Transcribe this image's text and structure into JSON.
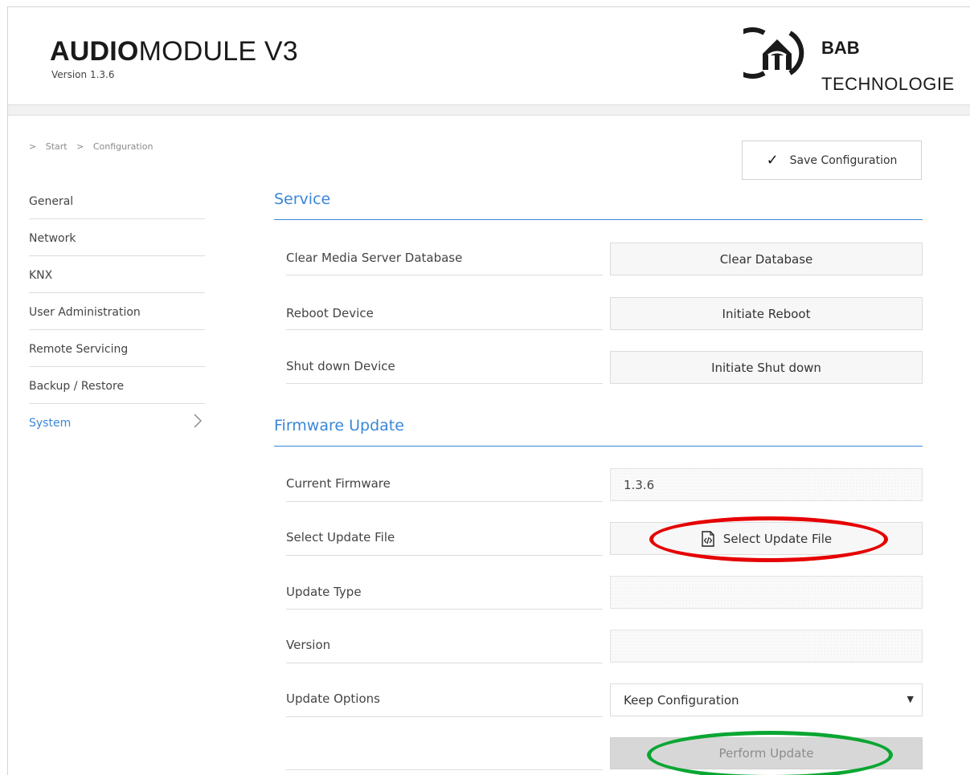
{
  "header": {
    "title_bold": "AUDIO",
    "title_rest": "MODULE V3",
    "version": "Version 1.3.6",
    "logo_line1": "BAB",
    "logo_line2": "TECHNOLOGIE"
  },
  "breadcrumb": [
    ">",
    "Start",
    ">",
    "Configuration"
  ],
  "toolbar": {
    "save_label": "Save Configuration"
  },
  "sidebar": {
    "items": [
      {
        "label": "General"
      },
      {
        "label": "Network"
      },
      {
        "label": "KNX"
      },
      {
        "label": "User Administration"
      },
      {
        "label": "Remote Servicing"
      },
      {
        "label": "Backup / Restore"
      },
      {
        "label": "System"
      }
    ],
    "active": "System"
  },
  "service": {
    "title": "Service",
    "rows": [
      {
        "label": "Clear Media Server Database",
        "button": "Clear Database"
      },
      {
        "label": "Reboot Device",
        "button": "Initiate Reboot"
      },
      {
        "label": "Shut down Device",
        "button": "Initiate Shut down"
      }
    ]
  },
  "firmware": {
    "title": "Firmware Update",
    "current_label": "Current Firmware",
    "current_value": "1.3.6",
    "select_label": "Select Update File",
    "select_button": "Select Update File",
    "type_label": "Update Type",
    "type_value": "",
    "version_label": "Version",
    "version_value": "",
    "options_label": "Update Options",
    "options_selected": "Keep Configuration",
    "perform_button": "Perform Update"
  },
  "colors": {
    "accent": "#3a87d6",
    "highlight_red": "#e60000",
    "highlight_green": "#0aa632",
    "disabled_button": "#d7d7d7"
  },
  "icons": [
    "check-icon",
    "chevron-right-icon",
    "file-code-icon",
    "dropdown-arrow-icon",
    "bab-logo-icon"
  ]
}
